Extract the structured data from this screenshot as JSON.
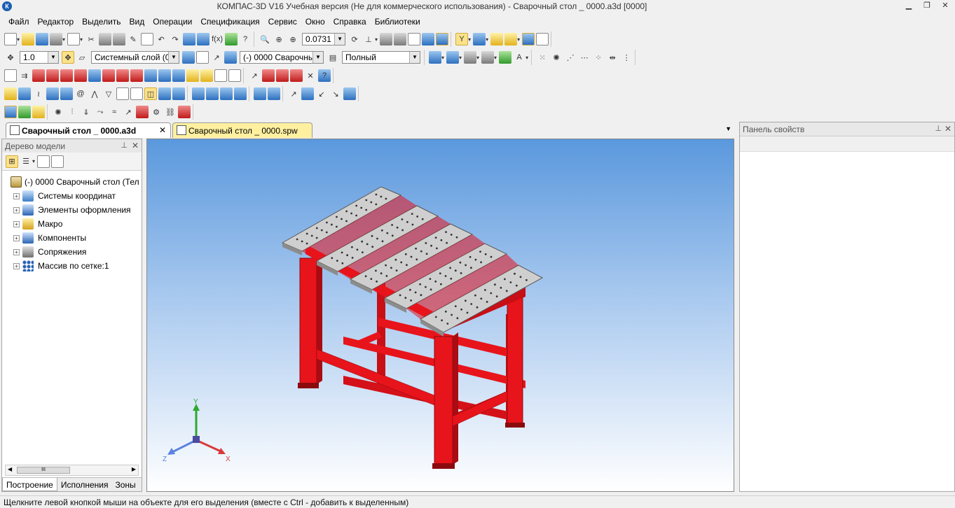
{
  "window": {
    "title": "КОМПАС-3D V16 Учебная версия  (Не для коммерческого использования) - Сварочный стол _ 0000.a3d [0000]"
  },
  "menu": [
    "Файл",
    "Редактор",
    "Выделить",
    "Вид",
    "Операции",
    "Спецификация",
    "Сервис",
    "Окно",
    "Справка",
    "Библиотеки"
  ],
  "toolbar": {
    "zoom_value": "0.0731",
    "step_value": "1.0",
    "layer_value": "Системный слой (0)",
    "part_value": "(-) 0000 Сварочный",
    "display_mode": "Полный"
  },
  "tabs": [
    {
      "label": "Сварочный стол _ 0000.a3d",
      "active": true
    },
    {
      "label": "Сварочный стол _ 0000.spw",
      "active": false
    }
  ],
  "tree": {
    "header": "Дерево модели",
    "root": "(-) 0000 Сварочный стол (Тел",
    "items": [
      "Системы координат",
      "Элементы оформления",
      "Макро",
      "Компоненты",
      "Сопряжения",
      "Массив по сетке:1"
    ],
    "scroll_thumb": "III",
    "bottom_tabs": [
      "Построение",
      "Исполнения",
      "Зоны"
    ]
  },
  "axes": {
    "x": "X",
    "y": "Y",
    "z": "Z"
  },
  "properties": {
    "header": "Панель свойств"
  },
  "status": "Щелкните левой кнопкой мыши на объекте для его выделения (вместе с Ctrl - добавить к выделенным)",
  "colors": {
    "frame": "#e8141b",
    "plate": "#c9c9c9",
    "viewport_top": "#5a98dd"
  }
}
